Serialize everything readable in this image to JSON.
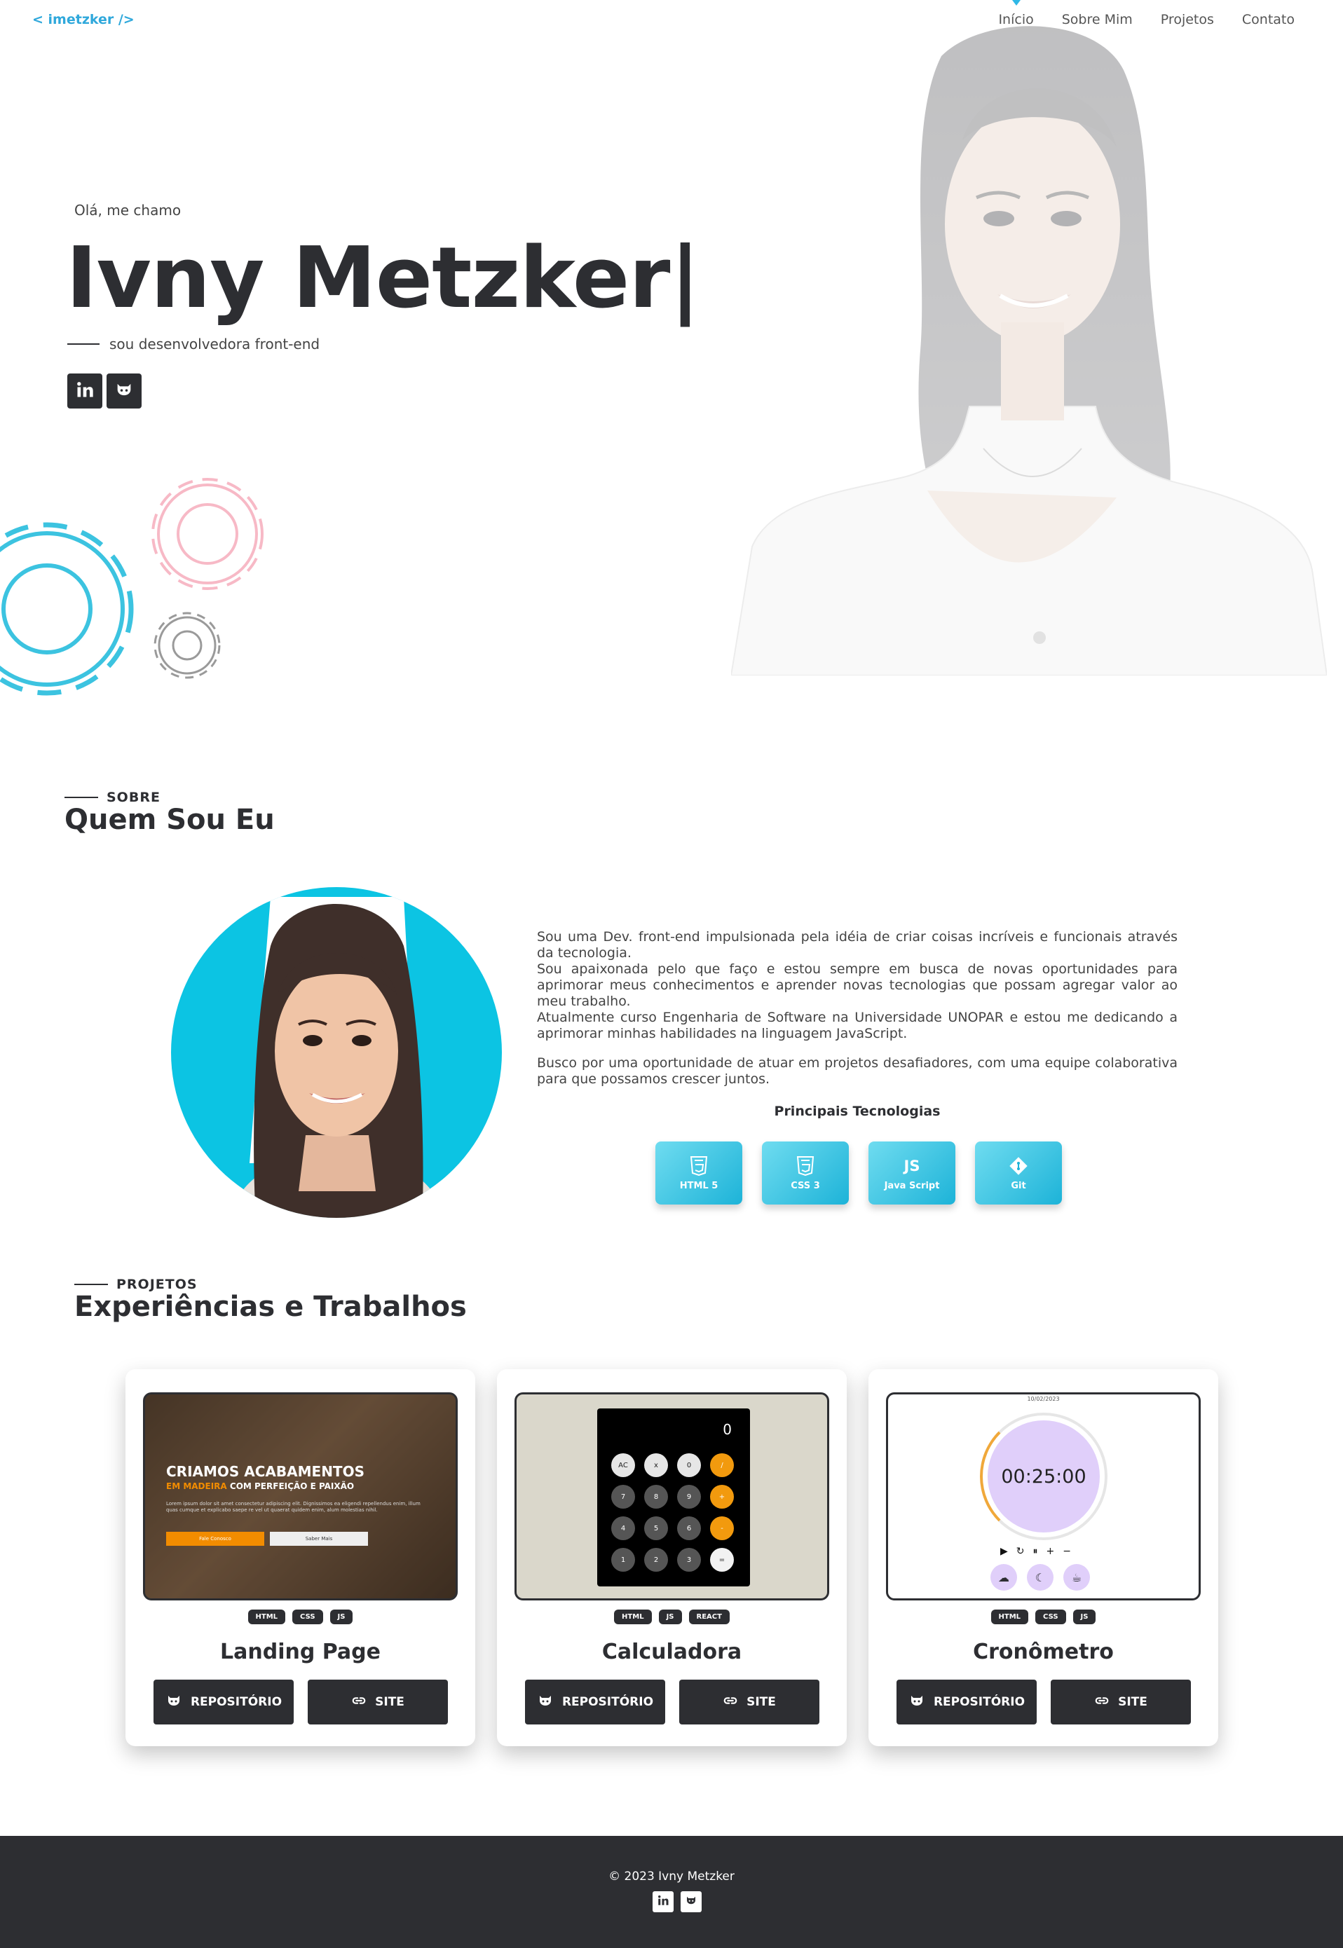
{
  "nav": {
    "logo": "< imetzker />",
    "links": [
      "Início",
      "Sobre Mim",
      "Projetos",
      "Contato"
    ],
    "active_index": 0
  },
  "hero": {
    "greeting": "Olá, me chamo",
    "name": "Ivny Metzker|",
    "tagline": "sou desenvolvedora front-end",
    "social": [
      "linkedin-icon",
      "github-icon"
    ]
  },
  "about": {
    "kicker": "SOBRE",
    "heading": "Quem Sou Eu",
    "paragraphs": [
      "Sou uma Dev. front-end impulsionada pela idéia de criar coisas incríveis e funcionais através da tecnologia.",
      "Sou apaixonada pelo que faço e estou sempre em busca de novas oportunidades para aprimorar meus conhecimentos e aprender novas tecnologias que possam agregar valor ao meu trabalho.",
      "Atualmente curso Engenharia de Software na Universidade UNOPAR e estou me dedicando a aprimorar minhas habilidades na linguagem JavaScript.",
      "Busco por uma oportunidade de atuar em projetos desafiadores, com uma equipe colaborativa para que possamos crescer juntos."
    ],
    "tech_title": "Principais Tecnologias",
    "techs": [
      {
        "icon": "html5-icon",
        "label": "HTML 5"
      },
      {
        "icon": "css3-icon",
        "label": "CSS 3"
      },
      {
        "icon": "js-icon",
        "icon_text": "JS",
        "label": "Java Script"
      },
      {
        "icon": "git-icon",
        "label": "Git"
      }
    ]
  },
  "projects": {
    "kicker": "PROJETOS",
    "heading": "Experiências e Trabalhos",
    "repo_label": "REPOSITÓRIO",
    "site_label": "SITE",
    "items": [
      {
        "title": "Landing Page",
        "badges": [
          "HTML",
          "CSS",
          "JS"
        ],
        "preview": {
          "headline": "CRIAMOS ACABAMENTOS",
          "sub_highlight": "EM MADEIRA",
          "sub_rest": " COM PERFEIÇÃO E PAIXÃO",
          "body": "Lorem ipsum dolor sit amet consectetur adipiscing elit. Dignissimos ea eligendi repellendus enim, illum quas cumque et explicabo saepe re vel ut quaerat quidem enim, alum molestias nihil.",
          "btn1": "Fale Conosco",
          "btn2": "Saber Mais"
        }
      },
      {
        "title": "Calculadora",
        "badges": [
          "HTML",
          "JS",
          "REACT"
        ],
        "preview": {
          "display": "0",
          "keys": [
            "AC",
            "x",
            "0",
            "/",
            "7",
            "8",
            "9",
            "+",
            "4",
            "5",
            "6",
            "-",
            "1",
            "2",
            "3",
            "="
          ]
        }
      },
      {
        "title": "Cronômetro",
        "badges": [
          "HTML",
          "CSS",
          "JS"
        ],
        "preview": {
          "date": "10/02/2023",
          "time": "00:25:00"
        }
      }
    ]
  },
  "footer": {
    "copyright": "© 2023 Ivny Metzker"
  },
  "colors": {
    "dark": "#2d2e32",
    "accent": "#2fa8db",
    "cyan": "#1db3d8",
    "orange": "#f28c00"
  }
}
